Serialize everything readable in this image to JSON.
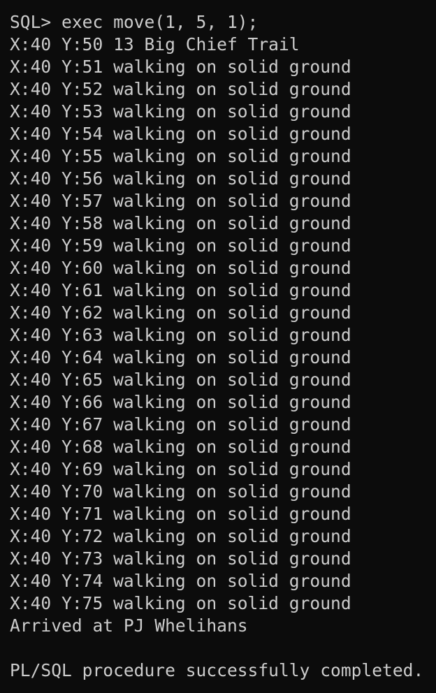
{
  "terminal": {
    "lines": [
      "SQL> exec move(1, 5, 1);",
      "X:40 Y:50 13 Big Chief Trail",
      "X:40 Y:51 walking on solid ground",
      "X:40 Y:52 walking on solid ground",
      "X:40 Y:53 walking on solid ground",
      "X:40 Y:54 walking on solid ground",
      "X:40 Y:55 walking on solid ground",
      "X:40 Y:56 walking on solid ground",
      "X:40 Y:57 walking on solid ground",
      "X:40 Y:58 walking on solid ground",
      "X:40 Y:59 walking on solid ground",
      "X:40 Y:60 walking on solid ground",
      "X:40 Y:61 walking on solid ground",
      "X:40 Y:62 walking on solid ground",
      "X:40 Y:63 walking on solid ground",
      "X:40 Y:64 walking on solid ground",
      "X:40 Y:65 walking on solid ground",
      "X:40 Y:66 walking on solid ground",
      "X:40 Y:67 walking on solid ground",
      "X:40 Y:68 walking on solid ground",
      "X:40 Y:69 walking on solid ground",
      "X:40 Y:70 walking on solid ground",
      "X:40 Y:71 walking on solid ground",
      "X:40 Y:72 walking on solid ground",
      "X:40 Y:73 walking on solid ground",
      "X:40 Y:74 walking on solid ground",
      "X:40 Y:75 walking on solid ground",
      "Arrived at PJ Whelihans",
      "",
      "PL/SQL procedure successfully completed."
    ]
  },
  "colors": {
    "background": "#0c0c0c",
    "text": "#cccccc"
  }
}
